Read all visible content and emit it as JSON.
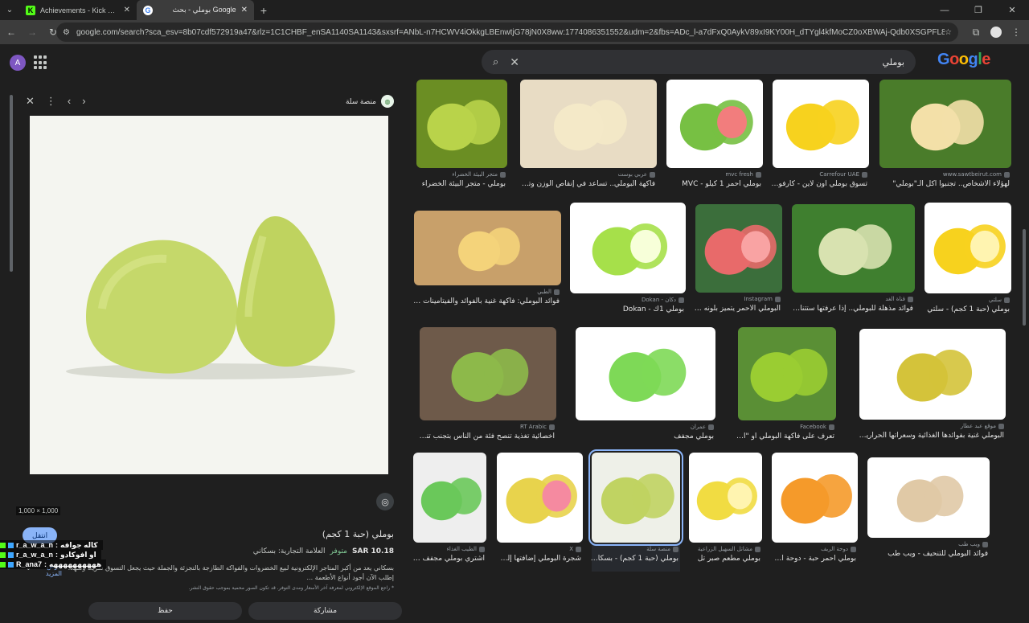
{
  "browser": {
    "tabs": [
      {
        "title": "Achievements - Kick Dashboard",
        "active": false
      },
      {
        "title": "بوملي - بحث Google",
        "active": true
      }
    ],
    "url": "google.com/search?sca_esv=8b07cdf572919a47&rlz=1C1CHBF_enSA1140SA1143&sxsrf=ANbL-n7HCWV4iOkkgLBEnwtjG78jN0X8ww:1774086351552&udm=2&fbs=ADc_l-a7dFxQ0AykV89xI9KY00H_dTYgl4kfMoCZ0oXBWAj-Qdb0XSGPFL804uWTnL4PU9NV5n0u1RSGx7MO..."
  },
  "account": {
    "initial": "A"
  },
  "search": {
    "query": "بوملي"
  },
  "logo": {
    "letters": [
      "G",
      "o",
      "o",
      "g",
      "l",
      "e"
    ]
  },
  "panel": {
    "source": "منصة سلة",
    "dimensions": "1,000 × 1,000",
    "visit_label": "انتقل",
    "title": "بوملي (حبة 1 كجم)",
    "price": "SAR 10.18",
    "stock": "متوفر",
    "brand": "العلامة التجارية: بسكاني",
    "description": "بسكاني يعد من أكبر المتاجر الإلكترونية لبيع الخضروات والفواكه الطازجة بالتجزئة والجملة حيث يجعل التسوق سريعاً وسهلاً. إطلب الآن أجود أنواع الأطعمة ...",
    "more": "عرض المزيد",
    "note": "* راجع الموقع الإلكتروني لمعرفة آخر الأسعار ومدى التوفر. قد تكون الصور محمية بموجب حقوق النشر.",
    "actions": [
      "حفظ",
      "مشاركة"
    ]
  },
  "results": [
    {
      "src": "متجر البيئة الخضراء",
      "cap": "بوملي - متجر البيئة الخضراء",
      "img": "tree"
    },
    {
      "src": "عربي بوست",
      "cap": "فاكهة البوملي.. تساعد في إنقاص الوزن وتعزيز...",
      "img": "peeled"
    },
    {
      "src": "mvc fresh",
      "cap": "بوملي احمر 1 كيلو - MVC",
      "img": "redcut"
    },
    {
      "src": "Carrefour UAE",
      "cap": "تسوق بوملي أون لاين - كارفور...",
      "img": "yellow"
    },
    {
      "src": "www.sawtbeirut.com",
      "cap": "لهؤلاء الأشخاص.. تجنبوا أكل الـ\"بوملي\"",
      "img": "segments"
    },
    {
      "src": "الطبي",
      "cap": "فوائد البوملي: فاكهة غنية بالفوائد والفيتامينات | الطبي",
      "img": "hands"
    },
    {
      "src": "Dokan - دكان",
      "cap": "بوملي 1ك - Dokan",
      "img": "greencut"
    },
    {
      "src": "Instagram",
      "cap": "البوملي الأحمر يتميز بلونه ا...",
      "img": "redhalves"
    },
    {
      "src": "قناة الغد",
      "cap": "فوائد مذهلة للبوملي.. إذا عرفتها ستتناولها...",
      "img": "opengreen"
    },
    {
      "src": "سلتي",
      "cap": "بوملي (حبة 1 كجم) - سلتي",
      "img": "yellowslice"
    },
    {
      "src": "RT Arabic",
      "cap": "أخصائية تغذية تنصح فئة من الناس بتجنب تناول فا...",
      "img": "market"
    },
    {
      "src": "عمران",
      "cap": "بوملي مجفف",
      "img": "dried"
    },
    {
      "src": "Facebook",
      "cap": "تعرف على فاكهة البوملي او \"الشادوك...",
      "img": "treegreen"
    },
    {
      "src": "موقع عبد عطار",
      "cap": "البوملي غنية بفوائدها الغذائية وسعراتها الحرارية القليلة",
      "img": "netted"
    },
    {
      "src": "الطيب الغذاء",
      "cap": "اشتري بوملي مجفف بأ...",
      "img": "bowl"
    },
    {
      "src": "X",
      "cap": "شجرة البوملي إضافتها إلى ا...",
      "img": "pinkcut"
    },
    {
      "src": "منصة سلة",
      "cap": "بوملي (حبة 1 كجم) - بسكاني",
      "img": "twogreen"
    },
    {
      "src": "مشاتل السهيل الزراعية",
      "cap": "بوملي مطعم صبر تل",
      "img": "yellowcut"
    },
    {
      "src": "دوحة الريف",
      "cap": "بوملي احمر حبة - دوحة ال...",
      "img": "orangenet"
    },
    {
      "src": "ويب طب",
      "cap": "فوائد البوملي للتنحيف - ويب طب",
      "img": "platter"
    }
  ],
  "chat": [
    {
      "user": "r_a_w_a_n",
      "msg": "كاله جوافه"
    },
    {
      "user": "r_a_w_a_n",
      "msg": "او افوكادو"
    },
    {
      "user": "R_ana7",
      "msg": "ههههههههههه"
    }
  ]
}
